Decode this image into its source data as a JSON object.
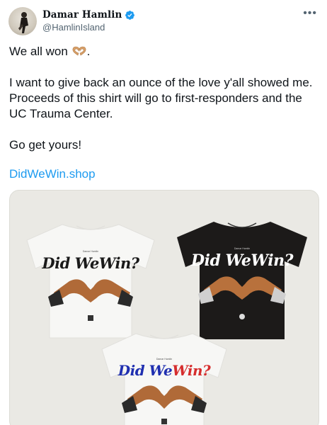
{
  "author": {
    "name": "Damar Hamlin",
    "handle": "@HamlinIsland",
    "verified": true
  },
  "more_icon": "•••",
  "tweet": {
    "line1": "We all won",
    "line1_end": ".",
    "line2": "I want to give back an ounce of the love y'all showed me. Proceeds of this shirt will go to first-responders and the UC Trauma Center.",
    "line3": "Go get yours!",
    "link": "DidWeWin.shop"
  },
  "media": {
    "shirts": [
      {
        "color": "white",
        "text": "Did WeWin?",
        "tiny": "Damar Hamlin"
      },
      {
        "color": "black",
        "text": "Did WeWin?",
        "tiny": "Damar Hamlin"
      },
      {
        "color": "white",
        "text_part1": "Did ",
        "text_part2": "We",
        "text_part3": "Win?",
        "tiny": "Damar Hamlin"
      }
    ]
  },
  "colors": {
    "link": "#1d9bf0",
    "verified": "#1d9bf0",
    "secondary_text": "#536471",
    "shirt_black": "#1c1a19",
    "shirt_white": "#f7f7f5",
    "blue_text": "#1f2fb0",
    "red_text": "#d62d2d"
  }
}
